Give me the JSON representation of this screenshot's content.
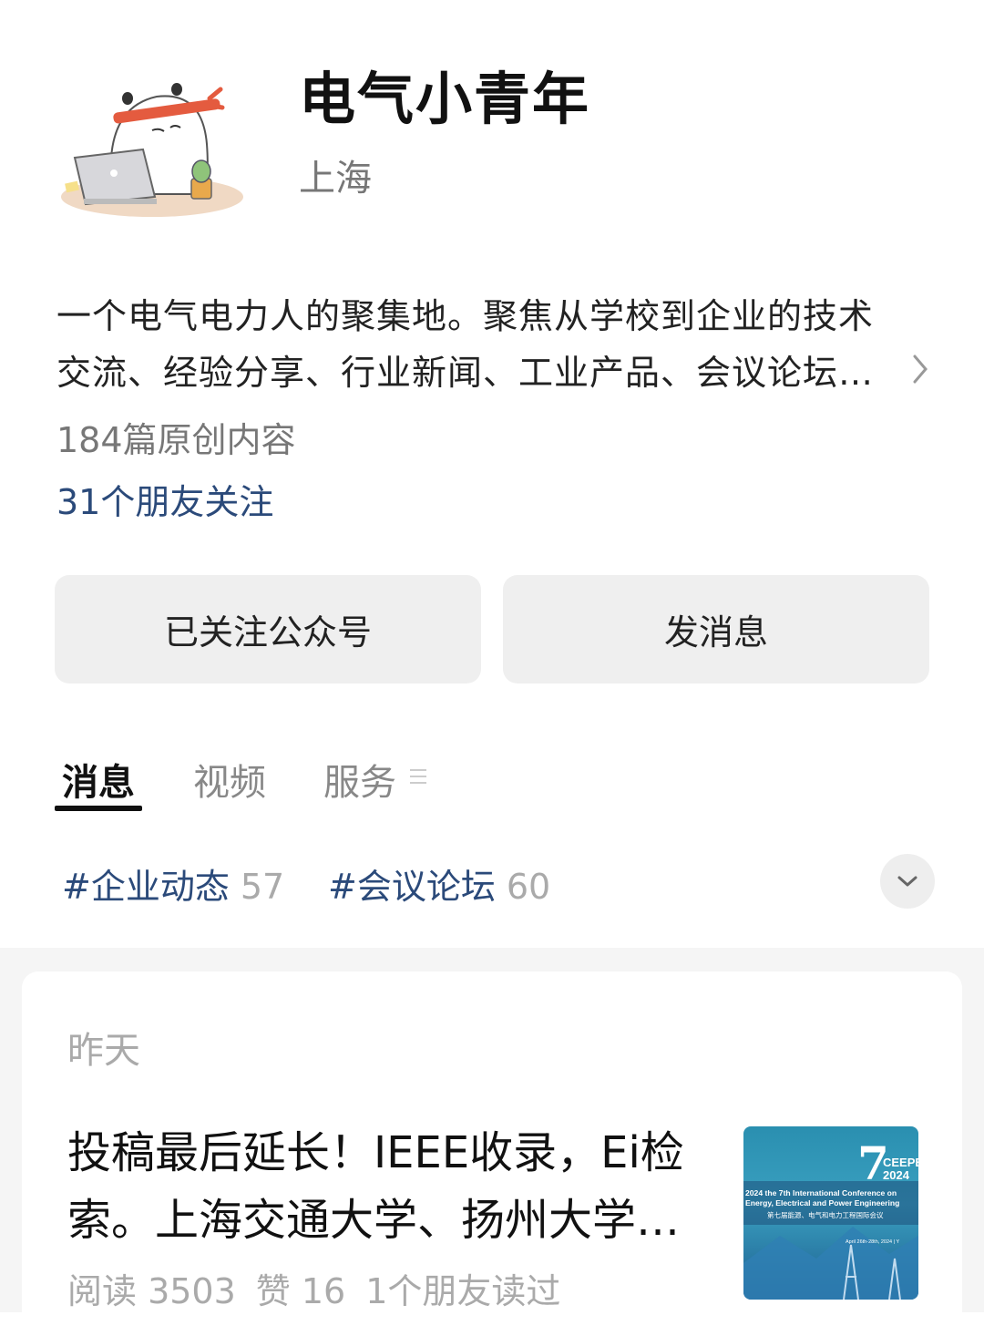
{
  "account": {
    "name": "电气小青年",
    "location": "上海",
    "description": "一个电气电力人的聚集地。聚焦从学校到企业的技术交流、经验分享、行业新闻、工业产品、会议论坛等资讯。",
    "original_count": "184篇原创内容",
    "friends_following": "31个朋友关注"
  },
  "actions": {
    "followed_label": "已关注公众号",
    "message_label": "发消息"
  },
  "tabs": [
    {
      "label": "消息",
      "active": true
    },
    {
      "label": "视频",
      "active": false
    },
    {
      "label": "服务",
      "active": false
    }
  ],
  "topics": [
    {
      "name": "#企业动态",
      "count": "57"
    },
    {
      "name": "#会议论坛",
      "count": "60"
    }
  ],
  "feed": {
    "date_label": "昨天",
    "article": {
      "title": "投稿最后延长！IEEE收录，Ei检索。上海交通大学、扬州大学联合主办",
      "reads": "阅读 3503",
      "likes": "赞 16",
      "friends_read": "1个朋友读过",
      "thumbnail": {
        "big_number": "7",
        "brand": "CEEPE",
        "year": "2024",
        "conf_line1": "2024 the 7th International Conference on",
        "conf_line2": "Energy, Electrical and Power Engineering",
        "cn_line": "第七届能源、电气和电力工程国际会议",
        "date_line": "April 26th-28th, 2024 | Y"
      }
    }
  },
  "colors": {
    "link_blue": "#2b4a7a",
    "button_bg": "#efefef",
    "muted": "#aaaaaa"
  }
}
